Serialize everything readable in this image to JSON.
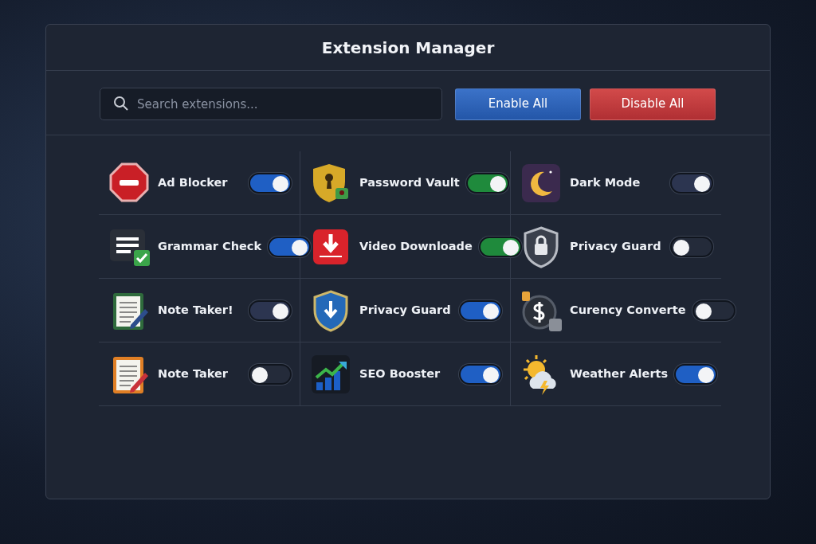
{
  "window": {
    "title": "Extension Manager"
  },
  "search": {
    "placeholder": "Search extensions..."
  },
  "buttons": [
    {
      "label": "Enable All",
      "kind": "enable"
    },
    {
      "label": "Disable All",
      "kind": "disable"
    }
  ],
  "extensions": [
    {
      "name": "Ad Blocker",
      "on": true,
      "color": "#1f5fc4"
    },
    {
      "name": "Password Vault",
      "on": true,
      "color": "#1f8a3c"
    },
    {
      "name": "Dark Mode",
      "on": true,
      "color": "#2c3550"
    },
    {
      "name": "Grammar Check",
      "on": true,
      "color": "#1f5fc4"
    },
    {
      "name": "Video Downloade",
      "on": true,
      "color": "#1f8a3c"
    },
    {
      "name": "Privacy Guard",
      "on": false,
      "color": "#242b3a"
    },
    {
      "name": "Note Taker!",
      "on": true,
      "color": "#2c3550"
    },
    {
      "name": "Privacy Guard",
      "on": true,
      "color": "#1f5fc4"
    },
    {
      "name": "Curency Converte",
      "on": false,
      "color": "#242b3a"
    },
    {
      "name": "Note Taker",
      "on": false,
      "color": "#242b3a"
    },
    {
      "name": "SEO Booster",
      "on": true,
      "color": "#1f5fc4"
    },
    {
      "name": "Weather Alerts",
      "on": true,
      "color": "#1f5fc4"
    }
  ]
}
